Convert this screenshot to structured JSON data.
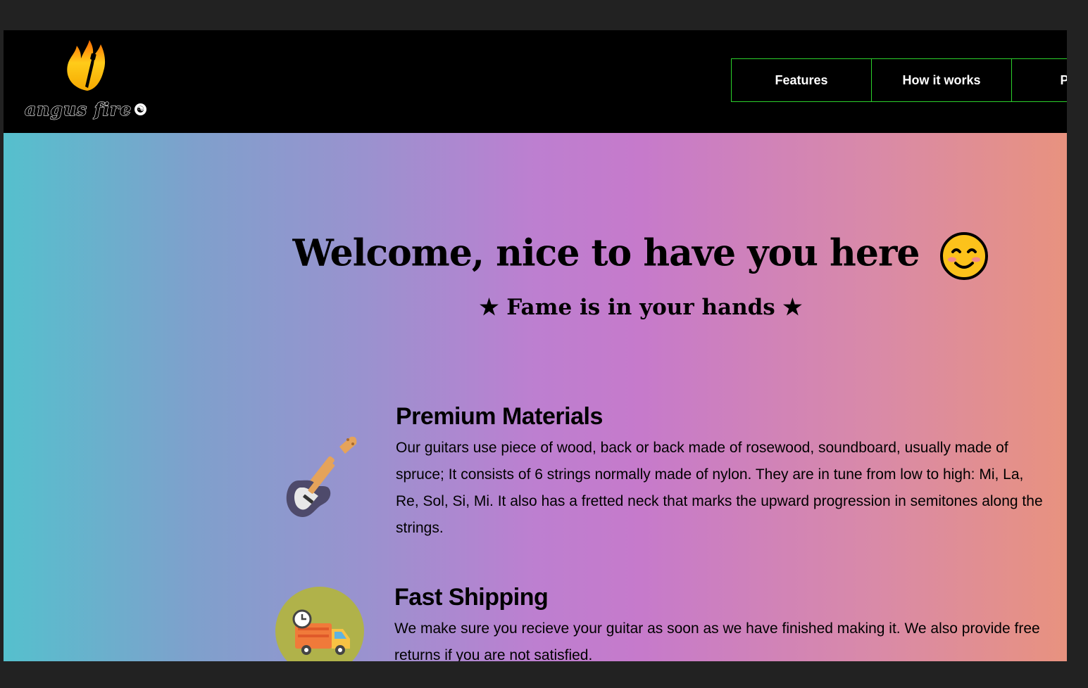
{
  "brand": {
    "logo_text": "angus fire",
    "logo_symbol": "☯",
    "logo_icon": "flame-guitar-icon"
  },
  "nav": {
    "items": [
      {
        "label": "Features"
      },
      {
        "label": "How it works"
      },
      {
        "label": "Pricing"
      }
    ],
    "border_color": "#2bd12b"
  },
  "hero": {
    "title": "Welcome, nice to have you here",
    "emoji": "smiling-face-icon",
    "subtitle": "★ Fame is in your hands ★"
  },
  "features": [
    {
      "icon": "electric-guitar-icon",
      "title": "Premium Materials",
      "text": "Our guitars use piece of wood, back or back made of rosewood, soundboard, usually made of spruce; It consists of 6 strings normally made of nylon. They are in tune from low to high: Mi, La, Re, Sol, Si, Mi. It also has a fretted neck that marks the upward progression in semitones along the strings."
    },
    {
      "icon": "delivery-truck-icon",
      "title": "Fast Shipping",
      "text": "We make sure you recieve your guitar as soon as we have finished making it. We also provide free returns if you are not satisfied."
    }
  ],
  "colors": {
    "header_bg": "#000000",
    "gradient_start": "#55c0cd",
    "gradient_mid": "#c67acb",
    "gradient_end": "#e8927f",
    "shipping_circle": "#b0b24a"
  }
}
